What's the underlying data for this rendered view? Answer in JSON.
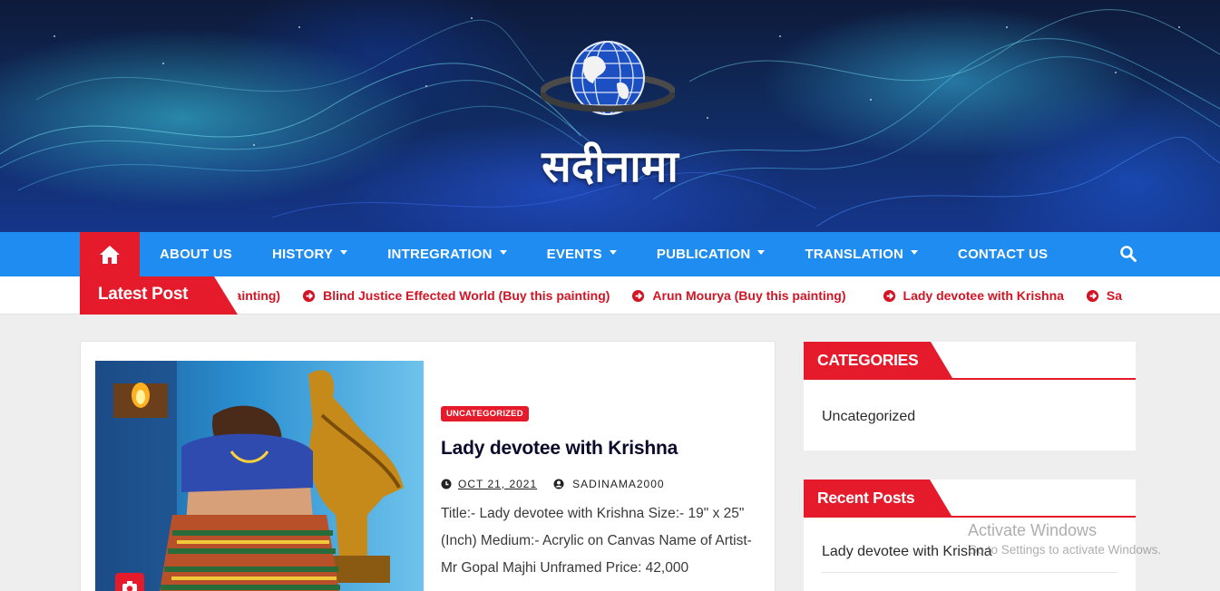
{
  "site": {
    "title": "सदीनामा"
  },
  "nav": {
    "home_icon": "home-icon",
    "items": [
      {
        "label": "ABOUT US",
        "dropdown": false
      },
      {
        "label": "HISTORY",
        "dropdown": true
      },
      {
        "label": "INTREGRATION",
        "dropdown": true
      },
      {
        "label": "EVENTS",
        "dropdown": true
      },
      {
        "label": "PUBLICATION",
        "dropdown": true
      },
      {
        "label": "TRANSLATION",
        "dropdown": true
      },
      {
        "label": "CONTACT US",
        "dropdown": false
      }
    ],
    "search_icon": "search-icon"
  },
  "ticker": {
    "label": "Latest Post",
    "items": [
      "painting)",
      "Blind Justice Effected World (Buy this painting)",
      "Arun Mourya (Buy this painting)",
      "Lady devotee with Krishna",
      "Sa"
    ]
  },
  "post": {
    "category": "UNCATEGORIZED",
    "title": "Lady devotee with Krishna",
    "date": "OCT 21, 2021",
    "author": "SADINAMA2000",
    "excerpt": "Title:- Lady devotee with Krishna Size:- 19\" x 25\" (Inch) Medium:- Acrylic on Canvas Name of Artist- Mr Gopal Majhi Unframed Price: 42,000"
  },
  "sidebar": {
    "categories": {
      "title": "CATEGORIES",
      "items": [
        "Uncategorized"
      ]
    },
    "recent": {
      "title": "Recent Posts",
      "items": [
        "Lady devotee with Krishna"
      ]
    }
  },
  "watermark": {
    "line1": "Activate Windows",
    "line2": "Go to Settings to activate Windows."
  },
  "colors": {
    "nav_blue": "#1e8cf0",
    "accent_red": "#e51a2a",
    "ticker_text": "#d31424"
  }
}
